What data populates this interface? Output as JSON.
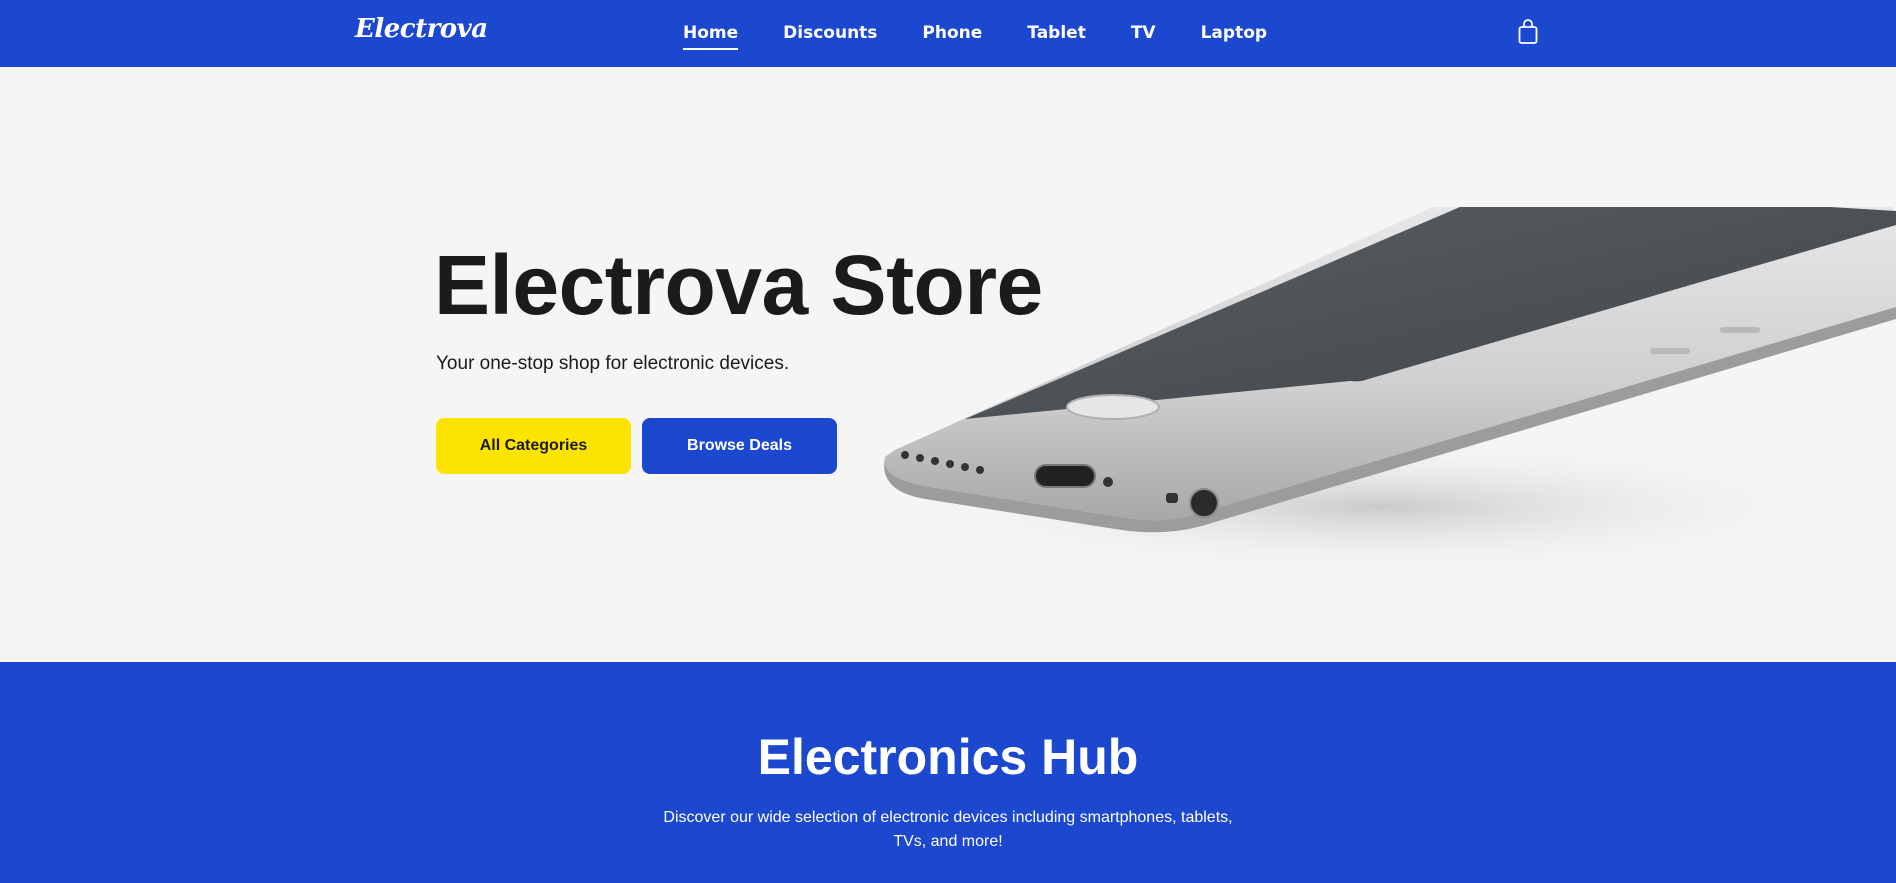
{
  "brand": {
    "logo_text": "Electrova"
  },
  "nav": {
    "items": [
      {
        "label": "Home",
        "active": true
      },
      {
        "label": "Discounts",
        "active": false
      },
      {
        "label": "Phone",
        "active": false
      },
      {
        "label": "Tablet",
        "active": false
      },
      {
        "label": "TV",
        "active": false
      },
      {
        "label": "Laptop",
        "active": false
      }
    ],
    "cart_icon": "shopping-bag-icon"
  },
  "hero": {
    "title": "Electrova Store",
    "subtitle": "Your one-stop shop for electronic devices.",
    "primary_button": "All Categories",
    "secondary_button": "Browse Deals",
    "image": "smartphone-image"
  },
  "hub": {
    "title": "Electronics Hub",
    "description": "Discover our wide selection of electronic devices including smartphones, tablets, TVs, and more!"
  },
  "colors": {
    "brand_blue": "#1c48cf",
    "accent_yellow": "#fde400",
    "hero_background": "#f5f5f5",
    "text_dark": "#1b1b1b"
  }
}
